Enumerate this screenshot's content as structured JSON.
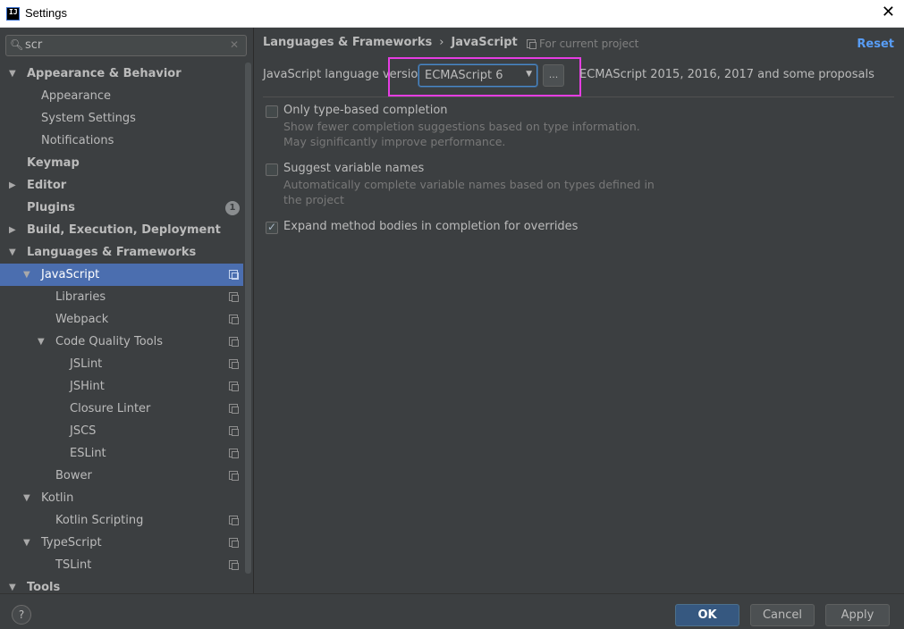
{
  "window": {
    "title": "Settings",
    "app_icon_text": "IJ",
    "close_glyph": "✕"
  },
  "search": {
    "value": "scr",
    "icon": "search-icon",
    "clear_glyph": "✕"
  },
  "tree": [
    {
      "label": "Appearance & Behavior",
      "depth": 0,
      "arrow": "expanded",
      "bold": true
    },
    {
      "label": "Appearance",
      "depth": 1
    },
    {
      "label": "System Settings",
      "depth": 1
    },
    {
      "label": "Notifications",
      "depth": 1
    },
    {
      "label": "Keymap",
      "depth": 0,
      "bold": true
    },
    {
      "label": "Editor",
      "depth": 0,
      "arrow": "collapsed",
      "bold": true
    },
    {
      "label": "Plugins",
      "depth": 0,
      "bold": true,
      "badge": "1"
    },
    {
      "label": "Build, Execution, Deployment",
      "depth": 0,
      "arrow": "collapsed",
      "bold": true
    },
    {
      "label": "Languages & Frameworks",
      "depth": 0,
      "arrow": "expanded",
      "bold": true
    },
    {
      "label": "JavaScript",
      "depth": 1,
      "arrow": "expanded",
      "selected": true,
      "project": true
    },
    {
      "label": "Libraries",
      "depth": 2,
      "project": true
    },
    {
      "label": "Webpack",
      "depth": 2,
      "project": true
    },
    {
      "label": "Code Quality Tools",
      "depth": 2,
      "arrow": "expanded",
      "project": true
    },
    {
      "label": "JSLint",
      "depth": 3,
      "project": true
    },
    {
      "label": "JSHint",
      "depth": 3,
      "project": true
    },
    {
      "label": "Closure Linter",
      "depth": 3,
      "project": true
    },
    {
      "label": "JSCS",
      "depth": 3,
      "project": true
    },
    {
      "label": "ESLint",
      "depth": 3,
      "project": true
    },
    {
      "label": "Bower",
      "depth": 2,
      "project": true
    },
    {
      "label": "Kotlin",
      "depth": 1,
      "arrow": "expanded"
    },
    {
      "label": "Kotlin Scripting",
      "depth": 2,
      "project": true
    },
    {
      "label": "TypeScript",
      "depth": 1,
      "arrow": "expanded",
      "project": true
    },
    {
      "label": "TSLint",
      "depth": 2,
      "project": true
    },
    {
      "label": "Tools",
      "depth": 0,
      "arrow": "expanded",
      "bold": true
    }
  ],
  "content": {
    "breadcrumb": {
      "parent": "Languages & Frameworks",
      "separator": "›",
      "current": "JavaScript"
    },
    "for_current_project": "For current project",
    "reset": "Reset",
    "language_version_label": "JavaScript language version",
    "language_version_value": "ECMAScript 6",
    "ellipsis_button": "...",
    "language_version_description": "ECMAScript 2015, 2016, 2017 and some proposals",
    "options": [
      {
        "label": "Only type-based completion",
        "checked": false,
        "hint": "Show fewer completion suggestions based on type information. May significantly improve performance."
      },
      {
        "label": "Suggest variable names",
        "checked": false,
        "hint": "Automatically complete variable names based on types defined in the project"
      },
      {
        "label": "Expand method bodies in completion for overrides",
        "checked": true,
        "hint": ""
      }
    ]
  },
  "footer": {
    "help": "?",
    "ok": "OK",
    "cancel": "Cancel",
    "apply": "Apply"
  },
  "colors": {
    "selection": "#4b6eaf",
    "link": "#589df6",
    "highlight_box": "#e53de2",
    "background": "#3c3f41"
  }
}
